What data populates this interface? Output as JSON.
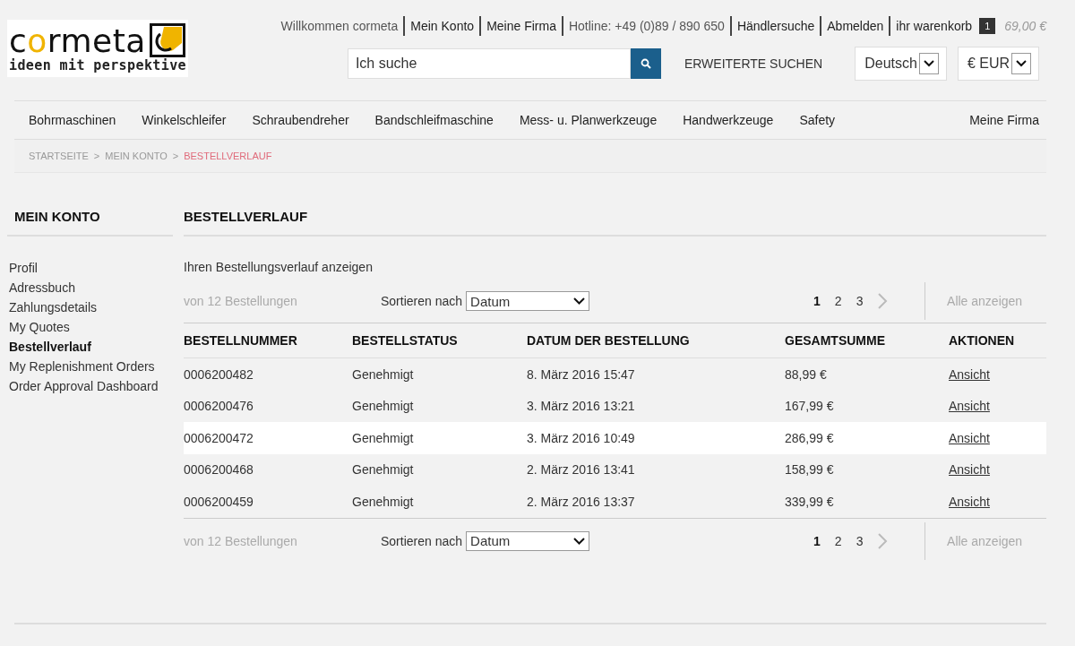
{
  "logo": {
    "name_parts": [
      {
        "text": "c",
        "accent": false
      },
      {
        "text": "o",
        "accent": true
      },
      {
        "text": "rmeta",
        "accent": false
      }
    ],
    "tagline": "ideen mit perspektive"
  },
  "top_links": [
    "Willkommen cormeta",
    "Mein Konto",
    "Meine Firma",
    "Hotline: +49 (0)89 / 890 650",
    "Händlersuche",
    "Abmelden"
  ],
  "cart": {
    "label": "ihr warenkorb",
    "count": "1",
    "total": "69,00 €"
  },
  "search": {
    "placeholder": "Ich suche",
    "advanced": "ERWEITERTE SUCHEN"
  },
  "language": "Deutsch",
  "currency": "€ EUR",
  "nav": [
    "Bohrmaschinen",
    "Winkelschleifer",
    "Schraubendreher",
    "Bandschleifmaschine",
    "Mess- u. Planwerkzeuge",
    "Handwerkzeuge",
    "Safety"
  ],
  "nav_right": "Meine Firma",
  "breadcrumb": [
    {
      "label": "STARTSEITE",
      "current": false
    },
    {
      "separator": ">",
      "label": "MEIN KONTO",
      "current": false
    },
    {
      "separator": ">",
      "label": "BESTELLVERLAUF",
      "current": true
    }
  ],
  "sidebar": {
    "title": "MEIN KONTO",
    "items": [
      {
        "label": "Profil",
        "selected": false
      },
      {
        "label": "Adressbuch",
        "selected": false
      },
      {
        "label": "Zahlungsdetails",
        "selected": false
      },
      {
        "label": "My Quotes",
        "selected": false
      },
      {
        "label": "Bestellverlauf",
        "selected": true
      },
      {
        "label": "My Replenishment Orders",
        "selected": false
      },
      {
        "label": "Order Approval Dashboard",
        "selected": false
      }
    ]
  },
  "main": {
    "title": "BESTELLVERLAUF",
    "intro": "Ihren Bestellungsverlauf anzeigen"
  },
  "pagers": [
    {
      "count": "von 12 Bestellungen",
      "sort_label": "Sortieren nach",
      "sort_value": "Datum",
      "pages": [
        {
          "label": "1",
          "selected": true
        },
        {
          "label": "2",
          "selected": false
        },
        {
          "label": "3",
          "selected": false
        }
      ],
      "show_all": "Alle anzeigen"
    },
    {
      "count": "von 12 Bestellungen",
      "sort_label": "Sortieren nach",
      "sort_value": "Datum",
      "pages": [
        {
          "label": "1",
          "selected": true
        },
        {
          "label": "2",
          "selected": false
        },
        {
          "label": "3",
          "selected": false
        }
      ],
      "show_all": "Alle anzeigen"
    }
  ],
  "table": {
    "columns": [
      "BESTELLNUMMER",
      "BESTELLSTATUS",
      "DATUM DER BESTELLUNG",
      "GESAMTSUMME",
      "AKTIONEN"
    ],
    "rows": [
      {
        "number": "0006200482",
        "status": "Genehmigt",
        "date": "8. März 2016 15:47",
        "total": "88,99 €",
        "action": "Ansicht",
        "highlighted": false
      },
      {
        "number": "0006200476",
        "status": "Genehmigt",
        "date": "3. März 2016 13:21",
        "total": "167,99 €",
        "action": "Ansicht",
        "highlighted": false
      },
      {
        "number": "0006200472",
        "status": "Genehmigt",
        "date": "3. März 2016 10:49",
        "total": "286,99 €",
        "action": "Ansicht",
        "highlighted": true
      },
      {
        "number": "0006200468",
        "status": "Genehmigt",
        "date": "2. März 2016 13:41",
        "total": "158,99 €",
        "action": "Ansicht",
        "highlighted": false
      },
      {
        "number": "0006200459",
        "status": "Genehmigt",
        "date": "2. März 2016 13:37",
        "total": "339,99 €",
        "action": "Ansicht",
        "highlighted": false
      }
    ]
  }
}
